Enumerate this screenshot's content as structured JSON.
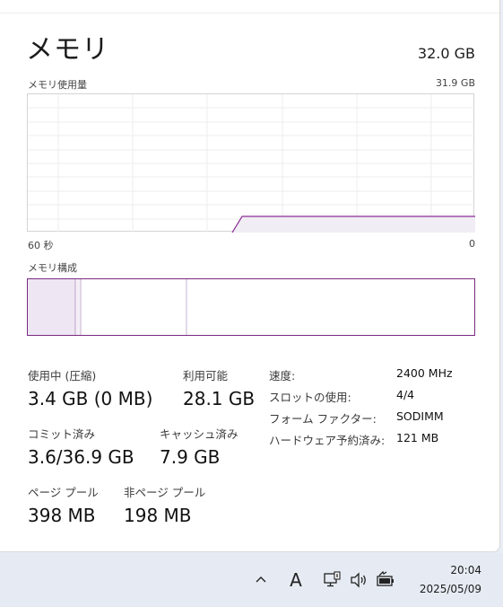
{
  "window": {
    "title": "メモリ",
    "total_capacity": "32.0 GB"
  },
  "usage_graph": {
    "label": "メモリ使用量",
    "max_label": "31.9 GB",
    "time_left": "60 秒",
    "time_right": "0",
    "line_color": "#8b2f95",
    "fill_color": "#f1edf5"
  },
  "composition": {
    "label": "メモリ構成",
    "border_color": "#7a2a82",
    "in_use_color": "#efe6f3"
  },
  "stats": {
    "in_use_label": "使用中 (圧縮)",
    "in_use_value": "3.4 GB (0 MB)",
    "available_label": "利用可能",
    "available_value": "28.1 GB",
    "committed_label": "コミット済み",
    "committed_value": "3.6/36.9 GB",
    "cached_label": "キャッシュ済み",
    "cached_value": "7.9 GB",
    "paged_label": "ページ プール",
    "paged_value": "398 MB",
    "nonpaged_label": "非ページ プール",
    "nonpaged_value": "198 MB"
  },
  "details": [
    {
      "label": "速度:",
      "value": "2400 MHz"
    },
    {
      "label": "スロットの使用:",
      "value": "4/4"
    },
    {
      "label": "フォーム ファクター:",
      "value": "SODIMM"
    },
    {
      "label": "ハードウェア予約済み:",
      "value": "121 MB"
    }
  ],
  "taskbar": {
    "ime_indicator": "A",
    "time": "20:04",
    "date": "2025/05/09",
    "icons": [
      "chevron-up-icon",
      "ime-icon",
      "network-icon",
      "volume-icon",
      "battery-icon"
    ]
  }
}
